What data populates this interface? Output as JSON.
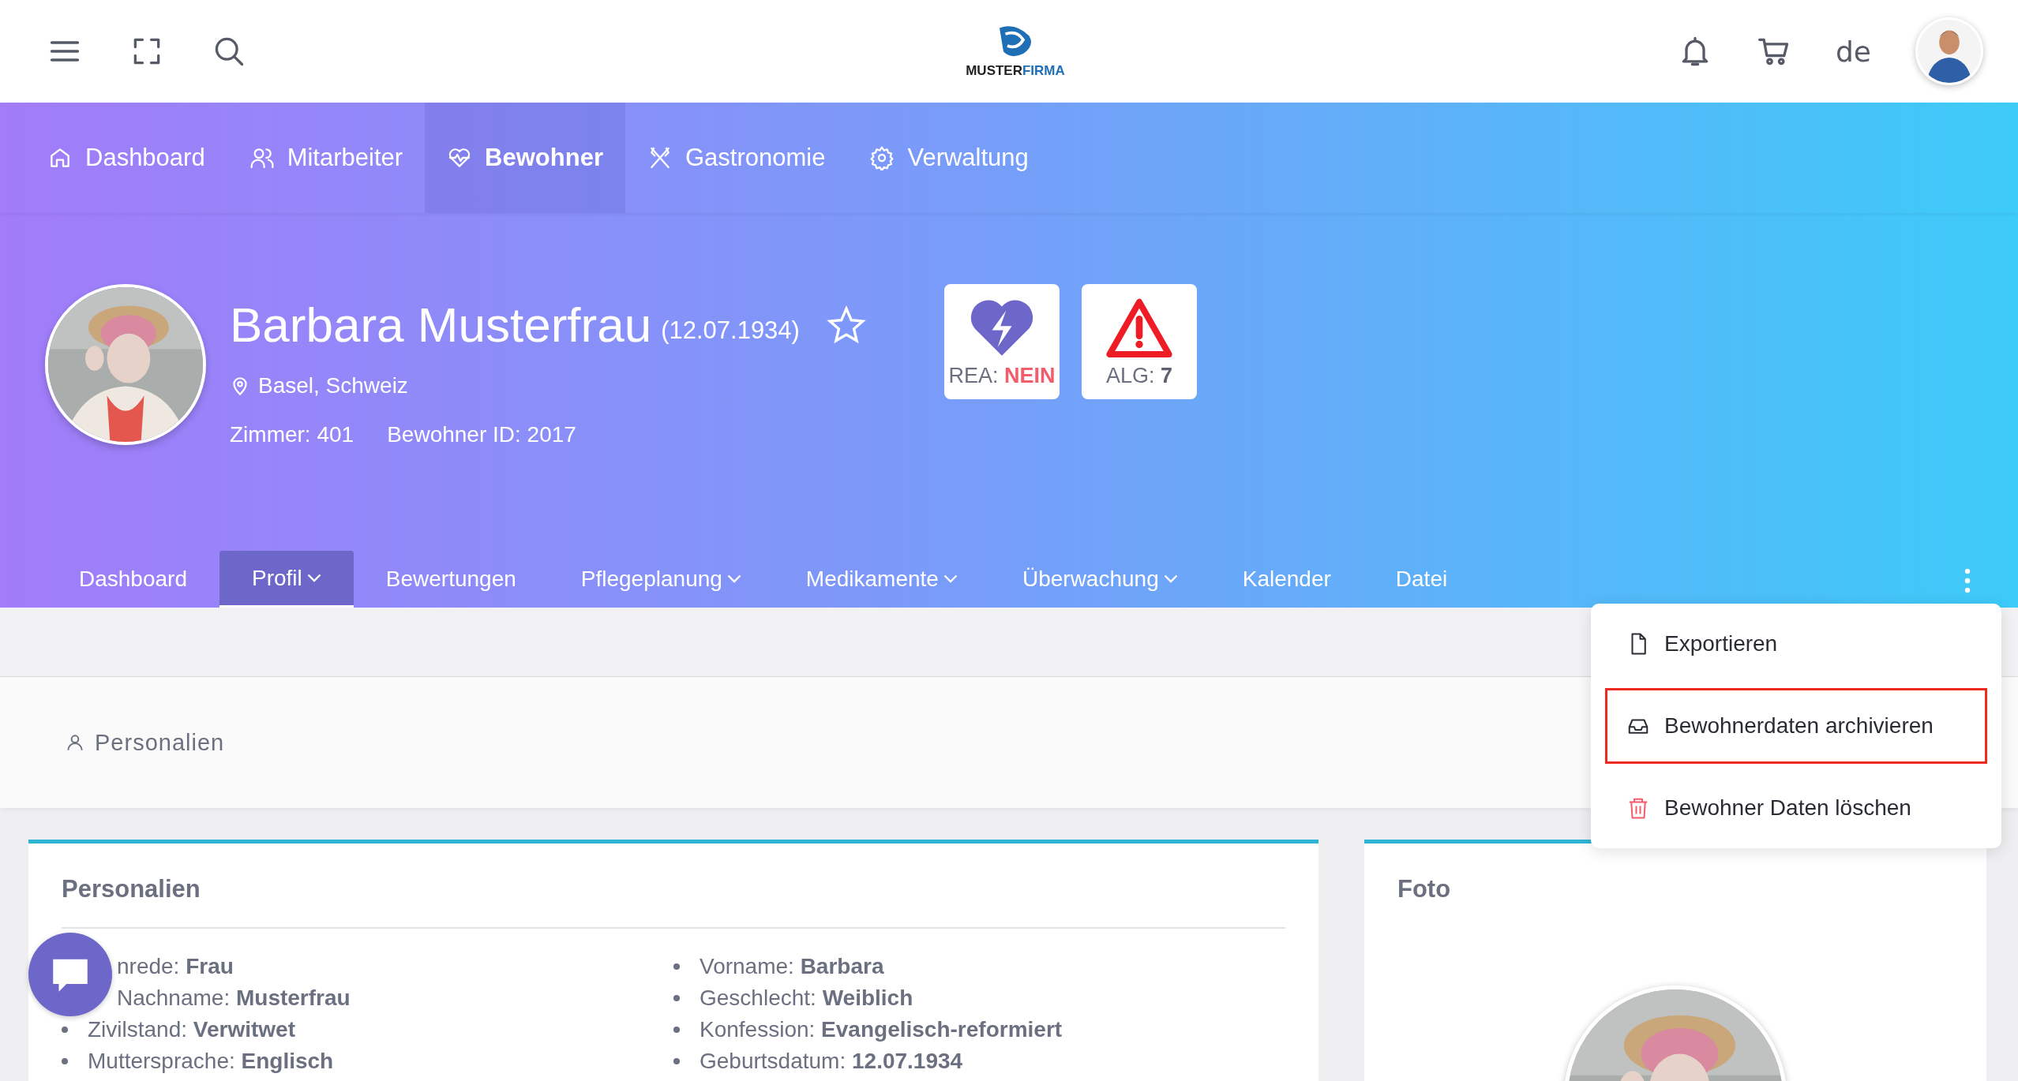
{
  "top_bar": {
    "logo": {
      "name_dark": "MUSTER",
      "name_blue": "FIRMA"
    },
    "language": "de"
  },
  "main_nav": [
    {
      "label": "Dashboard",
      "kind": "home",
      "selected": false
    },
    {
      "label": "Mitarbeiter",
      "kind": "users",
      "selected": false
    },
    {
      "label": "Bewohner",
      "kind": "health",
      "selected": true
    },
    {
      "label": "Gastronomie",
      "kind": "food",
      "selected": false
    },
    {
      "label": "Verwaltung",
      "kind": "admin",
      "selected": false
    }
  ],
  "resident": {
    "name": "Barbara Musterfrau",
    "birth_date": "(12.07.1934)",
    "favorite": false,
    "location": "Basel, Schweiz",
    "room": "Zimmer: 401",
    "resident_id": "Bewohner ID: 2017"
  },
  "badges": [
    {
      "kind": "rea",
      "label": "REA:",
      "value": "NEIN"
    },
    {
      "kind": "alg",
      "label": "ALG:",
      "value": "7"
    }
  ],
  "profile_tabs": [
    {
      "label": "Dashboard",
      "dropdown": false,
      "selected": false
    },
    {
      "label": "Profil",
      "dropdown": true,
      "selected": true
    },
    {
      "label": "Bewertungen",
      "dropdown": false,
      "selected": false
    },
    {
      "label": "Pflegeplanung",
      "dropdown": true,
      "selected": false
    },
    {
      "label": "Medikamente",
      "dropdown": true,
      "selected": false
    },
    {
      "label": "Überwachung",
      "dropdown": true,
      "selected": false
    },
    {
      "label": "Kalender",
      "dropdown": false,
      "selected": false
    },
    {
      "label": "Datei",
      "dropdown": false,
      "selected": false
    }
  ],
  "menu": [
    {
      "label": "Exportieren",
      "kind": "export",
      "highlighted": false
    },
    {
      "label": "Bewohnerdaten archivieren",
      "kind": "archive",
      "highlighted": true
    },
    {
      "label": "Bewohner Daten löschen",
      "kind": "delete",
      "highlighted": false
    }
  ],
  "section_bar": {
    "title": "Personalien"
  },
  "personal_card": {
    "title": "Personalien",
    "left": [
      {
        "label": "nrede:",
        "value": "Frau",
        "bullet_visible": false
      },
      {
        "label": "Nachname:",
        "value": "Musterfrau",
        "bullet_visible": false
      },
      {
        "label": "Zivilstand:",
        "value": "Verwitwet",
        "bullet_visible": true
      },
      {
        "label": "Muttersprache:",
        "value": "Englisch",
        "bullet_visible": true
      }
    ],
    "right": [
      {
        "label": "Vorname:",
        "value": "Barbara",
        "bullet_visible": true
      },
      {
        "label": "Geschlecht:",
        "value": "Weiblich",
        "bullet_visible": true
      },
      {
        "label": "Konfession:",
        "value": "Evangelisch-reformiert",
        "bullet_visible": true
      },
      {
        "label": "Geburtsdatum:",
        "value": "12.07.1934",
        "bullet_visible": true
      }
    ]
  },
  "photo_card": {
    "title": "Foto"
  }
}
